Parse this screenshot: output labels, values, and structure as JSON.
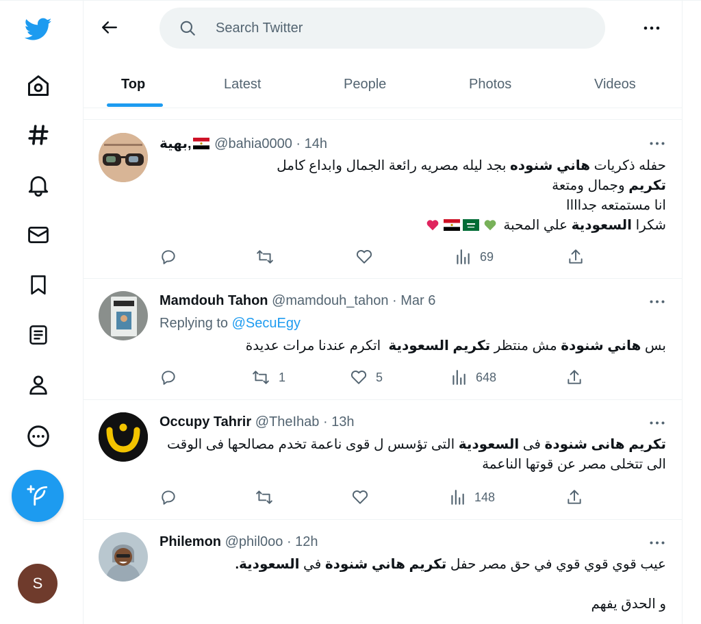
{
  "search": {
    "placeholder": "Search Twitter"
  },
  "tabs": [
    {
      "label": "Top"
    },
    {
      "label": "Latest"
    },
    {
      "label": "People"
    },
    {
      "label": "Photos"
    },
    {
      "label": "Videos"
    }
  ],
  "nav": {
    "icons": [
      "twitter-logo-icon",
      "home-icon",
      "explore-hashtag-icon",
      "notifications-bell-icon",
      "messages-envelope-icon",
      "bookmarks-icon",
      "lists-icon",
      "profile-icon",
      "more-circle-icon",
      "compose-tweet-icon"
    ],
    "avatar_letter": "S"
  },
  "colors": {
    "accent": "#1d9bf0",
    "text": "#0f1419",
    "secondary": "#536471",
    "avatar_me": "#6f3b2c"
  },
  "tweets": [
    {
      "name": "بهية,",
      "handle": "@bahia0000",
      "time": "14h",
      "line1_plain": "حفله ذكريات ",
      "line1_bold": "هاني شنوده",
      "line1_rest": " بجد ليله مصريه رائعة الجمال وابداع كامل",
      "line2_bold": "تكريم",
      "line2_rest": " وجمال ومتعة",
      "line3": "انا مستمتعه جداااا",
      "line4_plain": "شكرا ",
      "line4_bold": "السعودية",
      "line4_rest": " علي المحبة",
      "views": "69"
    },
    {
      "name": "Mamdouh Tahon",
      "handle": "@mamdouh_tahon",
      "time": "Mar 6",
      "replying_prefix": "Replying to",
      "replying_to": "@SecuEgy",
      "p1": "بس ",
      "b1": "هاني شنودة",
      "p2": " مش منتظر ",
      "b2": "تكريم السعودية",
      "p3": "  اتكرم عندنا مرات عديدة",
      "retweets": "1",
      "likes": "5",
      "views": "648"
    },
    {
      "name": "Occupy Tahrir",
      "handle": "@TheIhab",
      "time": "13h",
      "b1": "تكريم هانى شنودة",
      "p1": " فى ",
      "b2": "السعودية",
      "p2": " التى تؤسس ل قوى ناعمة تخدم مصالحها فى الوقت",
      "line2": "الى تتخلى مصر عن قوتها الناعمة",
      "views": "148"
    },
    {
      "name": "Philemon",
      "handle": "@phil0oo",
      "time": "12h",
      "p1": "عيب قوي قوي قوي في حق مصر حفل ",
      "b1": "تكريم هاني شنودة",
      "p2": " في ",
      "b2": "السعودية",
      "p3": ".",
      "line2": "و الحدق يفهم"
    }
  ]
}
